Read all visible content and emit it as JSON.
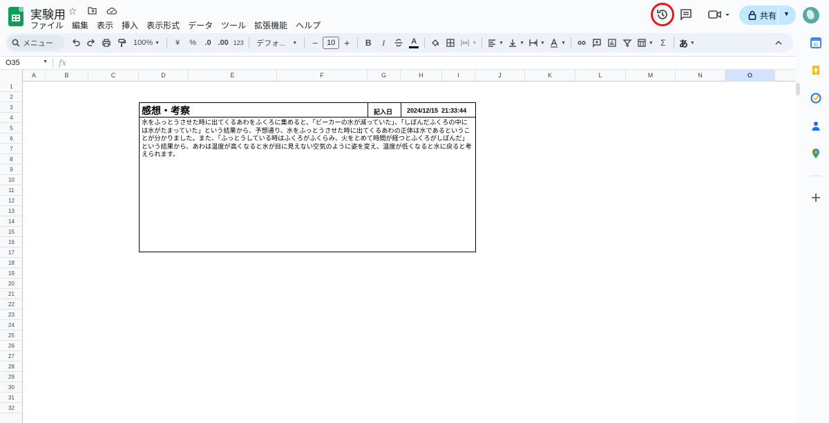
{
  "header": {
    "doc_title": "実験用",
    "menu": [
      "ファイル",
      "編集",
      "表示",
      "挿入",
      "表示形式",
      "データ",
      "ツール",
      "拡張機能",
      "ヘルプ"
    ],
    "share_label": "共有"
  },
  "toolbar": {
    "search_label": "メニュー",
    "zoom": "100%",
    "currency": "¥",
    "percent": "%",
    "dec_decrease": ".0",
    "dec_increase": ".00",
    "num_format": "123",
    "font": "デフォ...",
    "font_size": "10",
    "minus": "−",
    "plus": "+",
    "bold": "B",
    "italic": "I",
    "text_color_letter": "A",
    "input_tools": "あ"
  },
  "formula_bar": {
    "cell_ref": "O35",
    "fx": "fx"
  },
  "columns": [
    "A",
    "B",
    "C",
    "D",
    "E",
    "F",
    "G",
    "H",
    "I",
    "J",
    "K",
    "L",
    "M",
    "N",
    "O"
  ],
  "selected_column": "O",
  "rows": [
    "1",
    "2",
    "3",
    "4",
    "5",
    "6",
    "7",
    "8",
    "9",
    "10",
    "11",
    "12",
    "13",
    "14",
    "15",
    "16",
    "17",
    "18",
    "19",
    "20",
    "21",
    "22",
    "23",
    "24",
    "25",
    "26",
    "27",
    "28",
    "29",
    "30",
    "31",
    "32"
  ],
  "memo": {
    "title": "感想・考察",
    "date_label": "記入日",
    "date_value": "2024/12/15  21:33:44",
    "body": "水をふっとうさせた時に出てくるあわをふくろに集めると、「ビーカーの水が減っていた」、「しぼんだふくろの中には水がたまっていた」という結果から、予想通り、水をふっとうさせた時に出てくるあわの正体は水であるということが分かりました。また、「ふっとうしている時はふくろがふくらみ、火をとめて時間が経つとふくろがしぼんだ」という結果から、あわは温度が高くなると水が目に見えない空気のように姿を変え、温度が低くなると水に戻ると考えられます。"
  },
  "colors": {
    "accent_highlight": "#e8141a",
    "share_bg": "#c2e7ff",
    "toolbar_bg": "#edf2fa",
    "selected_col": "#d3e3fd"
  }
}
